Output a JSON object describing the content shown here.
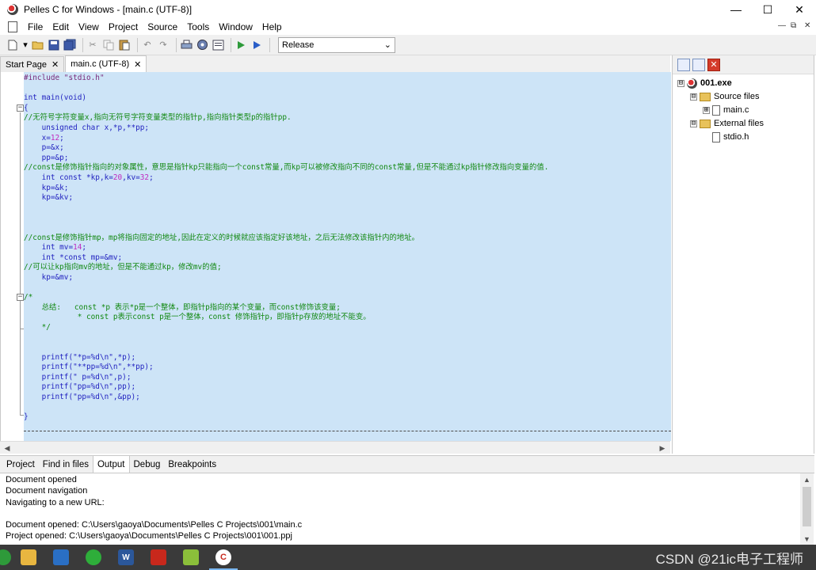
{
  "window": {
    "title": "Pelles C for Windows - [main.c (UTF-8)]",
    "minimize_glyph": "—",
    "maximize_glyph": "☐",
    "close_glyph": "✕"
  },
  "menu": [
    "File",
    "Edit",
    "View",
    "Project",
    "Source",
    "Tools",
    "Window",
    "Help"
  ],
  "mdi_controls": [
    "—",
    "⧉",
    "✕"
  ],
  "toolbar": {
    "config_value": "Release",
    "icons": [
      "new-file-icon",
      "dropdown-arrow-icon",
      "open-folder-icon",
      "save-icon",
      "save-all-icon",
      "cut-icon",
      "copy-icon",
      "paste-icon",
      "undo-icon",
      "redo-icon",
      "print-icon",
      "build-icon",
      "project-icon",
      "go-icon",
      "execute-icon"
    ]
  },
  "tabs": [
    {
      "label": "Start Page",
      "active": false
    },
    {
      "label": "main.c (UTF-8)",
      "active": true
    }
  ],
  "code_lines": [
    [
      [
        "pp",
        "#include \"stdio.h\""
      ]
    ],
    [],
    [
      [
        "kw",
        "int main(void)"
      ]
    ],
    [
      [
        "kw",
        "{"
      ]
    ],
    [
      [
        "cm",
        "//无符号字符变量x,指向无符号字符变量类型的指针p,指向指针类型p的指针pp."
      ]
    ],
    [
      [
        "tx",
        "    unsigned char x,*p,**pp;"
      ]
    ],
    [
      [
        "tx",
        "    x="
      ],
      [
        "nm",
        "12"
      ],
      [
        "tx",
        ";"
      ]
    ],
    [
      [
        "tx",
        "    p=&x;"
      ]
    ],
    [
      [
        "tx",
        "    pp=&p;"
      ]
    ],
    [
      [
        "cm",
        "//const是修饰指针指向的对象属性，意思是指针kp只能指向一个const常量,而kp可以被修改指向不同的const常量,但是不能通过kp指针修改指向变量的值."
      ]
    ],
    [
      [
        "tx",
        "    int const *kp,k="
      ],
      [
        "nm",
        "20"
      ],
      [
        "tx",
        ",kv="
      ],
      [
        "nm",
        "32"
      ],
      [
        "tx",
        ";"
      ]
    ],
    [
      [
        "tx",
        "    kp=&k;"
      ]
    ],
    [
      [
        "tx",
        "    kp=&kv;"
      ]
    ],
    [],
    [],
    [],
    [
      [
        "cm",
        "//const是修饰指针mp，mp将指向固定的地址,因此在定义的时候就应该指定好该地址，之后无法修改该指针内的地址。"
      ]
    ],
    [
      [
        "tx",
        "    int mv="
      ],
      [
        "nm",
        "14"
      ],
      [
        "tx",
        ";"
      ]
    ],
    [
      [
        "tx",
        "    int *const mp=&mv;"
      ]
    ],
    [
      [
        "cm",
        "//可以让kp指向mv的地址，但是不能通过kp，修改mv的值;"
      ]
    ],
    [
      [
        "tx",
        "    kp=&mv;"
      ]
    ],
    [],
    [
      [
        "cm",
        "/*"
      ]
    ],
    [
      [
        "cm",
        "    总结:   const *p 表示*p是一个整体，即指针p指向的某个变量，而const修饰该变量;"
      ]
    ],
    [
      [
        "cm",
        "            * const p表示const p是一个整体，const 修饰指针p，即指针p存放的地址不能变。"
      ]
    ],
    [
      [
        "cm",
        "    */"
      ]
    ],
    [],
    [],
    [
      [
        "tx",
        "    printf(\"*p=%d\\n\",*p);"
      ]
    ],
    [
      [
        "tx",
        "    printf(\"**pp=%d\\n\",**pp);"
      ]
    ],
    [
      [
        "tx",
        "    printf(\" p=%d\\n\",p);"
      ]
    ],
    [
      [
        "tx",
        "    printf(\"pp=%d\\n\",pp);"
      ]
    ],
    [
      [
        "tx",
        "    printf(\"pp=%d\\n\",&pp);"
      ]
    ],
    [],
    [
      [
        "tx",
        "}"
      ]
    ]
  ],
  "project_tree": [
    {
      "label": "001.exe",
      "kind": "exe",
      "expander": "⊟",
      "bold": true
    },
    {
      "label": "Source files",
      "kind": "folder",
      "expander": "⊟"
    },
    {
      "label": "main.c",
      "kind": "file",
      "expander": "⊞"
    },
    {
      "label": "External files",
      "kind": "folder",
      "expander": "⊟"
    },
    {
      "label": "stdio.h",
      "kind": "file",
      "expander": ""
    }
  ],
  "output_tabs": [
    {
      "label": "Project",
      "active": false
    },
    {
      "label": "Find in files",
      "active": false
    },
    {
      "label": "Output",
      "active": true
    },
    {
      "label": "Debug",
      "active": false
    },
    {
      "label": "Breakpoints",
      "active": false
    }
  ],
  "output_lines": [
    "Document opened",
    "Document navigation",
    "Navigating to a new URL:",
    "",
    "Document opened: C:\\Users\\gaoya\\Documents\\Pelles C Projects\\001\\main.c",
    "Project opened: C:\\Users\\gaoya\\Documents\\Pelles C Projects\\001\\001.ppj"
  ],
  "taskbar": {
    "apps": [
      "file-explorer-icon",
      "control-panel-icon",
      "wechat-icon",
      "word-icon",
      "pdf-icon",
      "editor-icon",
      "pelles-c-icon"
    ],
    "watermark": "CSDN @21ic电子工程师"
  },
  "colors": {
    "editor_bg": "#cde4f7",
    "keyword": "#1f1fbf",
    "comment": "#118811",
    "number": "#c02bc0",
    "preprocessor": "#7a2a7a"
  }
}
